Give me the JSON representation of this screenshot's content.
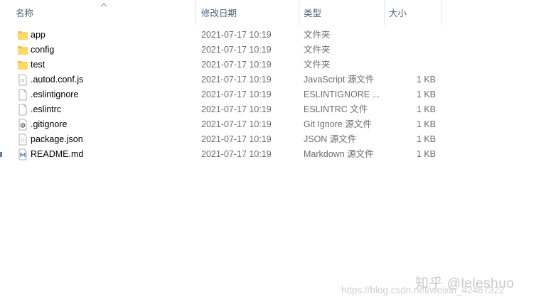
{
  "columns": {
    "name": "名称",
    "date": "修改日期",
    "type": "类型",
    "size": "大小"
  },
  "files": [
    {
      "name": "app",
      "date": "2021-07-17 10:19",
      "type": "文件夹",
      "size": "",
      "icon": "folder-icon"
    },
    {
      "name": "config",
      "date": "2021-07-17 10:19",
      "type": "文件夹",
      "size": "",
      "icon": "folder-icon"
    },
    {
      "name": "test",
      "date": "2021-07-17 10:19",
      "type": "文件夹",
      "size": "",
      "icon": "folder-icon"
    },
    {
      "name": ".autod.conf.js",
      "date": "2021-07-17 10:19",
      "type": "JavaScript 源文件",
      "size": "1 KB",
      "icon": "js-file-icon"
    },
    {
      "name": ".eslintignore",
      "date": "2021-07-17 10:19",
      "type": "ESLINTIGNORE ...",
      "size": "1 KB",
      "icon": "blank-file-icon"
    },
    {
      "name": ".eslintrc",
      "date": "2021-07-17 10:19",
      "type": "ESLINTRC 文件",
      "size": "1 KB",
      "icon": "blank-file-icon"
    },
    {
      "name": ".gitignore",
      "date": "2021-07-17 10:19",
      "type": "Git Ignore 源文件",
      "size": "1 KB",
      "icon": "gitignore-file-icon"
    },
    {
      "name": "package.json",
      "date": "2021-07-17 10:19",
      "type": "JSON 源文件",
      "size": "1 KB",
      "icon": "json-file-icon"
    },
    {
      "name": "README.md",
      "date": "2021-07-17 10:19",
      "type": "Markdown 源文件",
      "size": "1 KB",
      "icon": "markdown-file-icon"
    }
  ],
  "watermark": {
    "main": "知乎 @leleshuo",
    "url": "https://blog.csdn.net/weixin_42467322"
  },
  "colors": {
    "header_text": "#4c607a",
    "folder": "#f5c342",
    "secondary_text": "#6d6d6d"
  }
}
